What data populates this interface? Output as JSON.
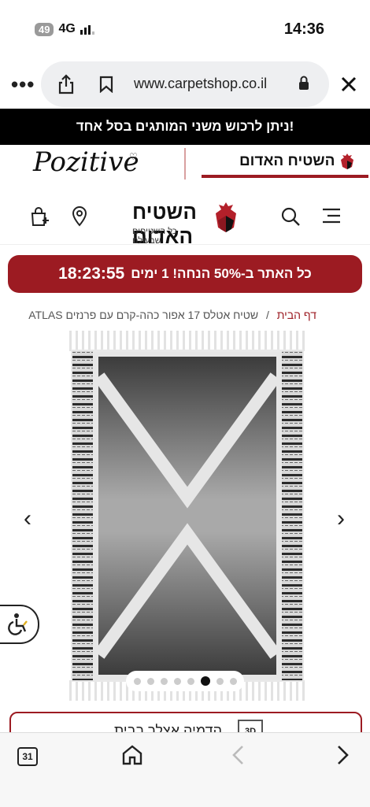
{
  "status_bar": {
    "time": "14:36",
    "battery": "49",
    "network": "4G"
  },
  "browser": {
    "url": "www.carpetshop.co.il"
  },
  "promo": {
    "text": "ניתן לרכוש משני המותגים בסל אחד!"
  },
  "brands": {
    "pozitive": "Pozitive",
    "red_carpet": "השטיח האדום"
  },
  "header": {
    "logo_name": "השטיח האדום",
    "logo_tagline": "כל השטיחים שבעולם"
  },
  "sale": {
    "text": "כל האתר ב-50% הנחה! 1 ימים",
    "timer": "18:23:55"
  },
  "breadcrumb": {
    "home": "דף הבית",
    "separator": "/",
    "current": "שטיח אטלס 17 אפור כהה-קרם עם פרנזים ATLAS"
  },
  "gallery": {
    "dots_count": 8,
    "active_dot": 6
  },
  "actions": {
    "view_3d": "הדמיה אצלך בבית",
    "badge_3d": "3D"
  },
  "bottom_bar": {
    "tabs_count": "31"
  },
  "colors": {
    "brand_red": "#9c1b22"
  }
}
